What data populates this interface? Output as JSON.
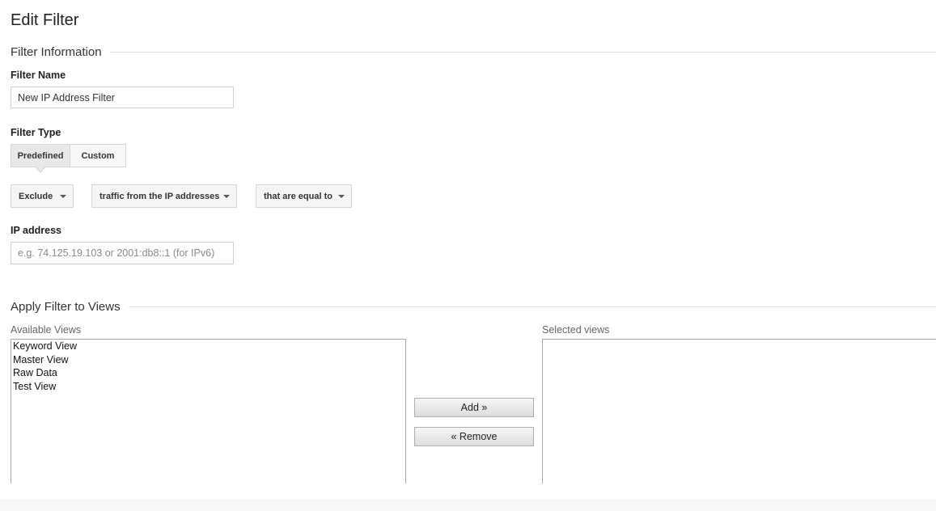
{
  "page": {
    "title": "Edit Filter"
  },
  "filter_information": {
    "section_title": "Filter Information",
    "name_label": "Filter Name",
    "name_value": "New IP Address Filter",
    "type_label": "Filter Type",
    "type_tabs": [
      "Predefined",
      "Custom"
    ],
    "type_selected": "Predefined",
    "exclude_dropdown": "Exclude",
    "source_dropdown": "traffic from the IP addresses",
    "expression_dropdown": "that are equal to",
    "ip_label": "IP address",
    "ip_placeholder": "e.g. 74.125.19.103 or 2001:db8::1 (for IPv6)"
  },
  "apply_filter": {
    "section_title": "Apply Filter to Views",
    "available_label": "Available Views",
    "available_views": [
      "Keyword View",
      "Master View",
      "Raw Data",
      "Test View"
    ],
    "selected_label": "Selected views",
    "selected_views": [],
    "add_button": "Add »",
    "remove_button": "« Remove"
  },
  "colors": {
    "section_rule": "#e0e0e0",
    "active_tab_bg": "#e8e8e8",
    "dropdown_bg": "#f5f5f5",
    "list_border": "#a9a9a9"
  }
}
